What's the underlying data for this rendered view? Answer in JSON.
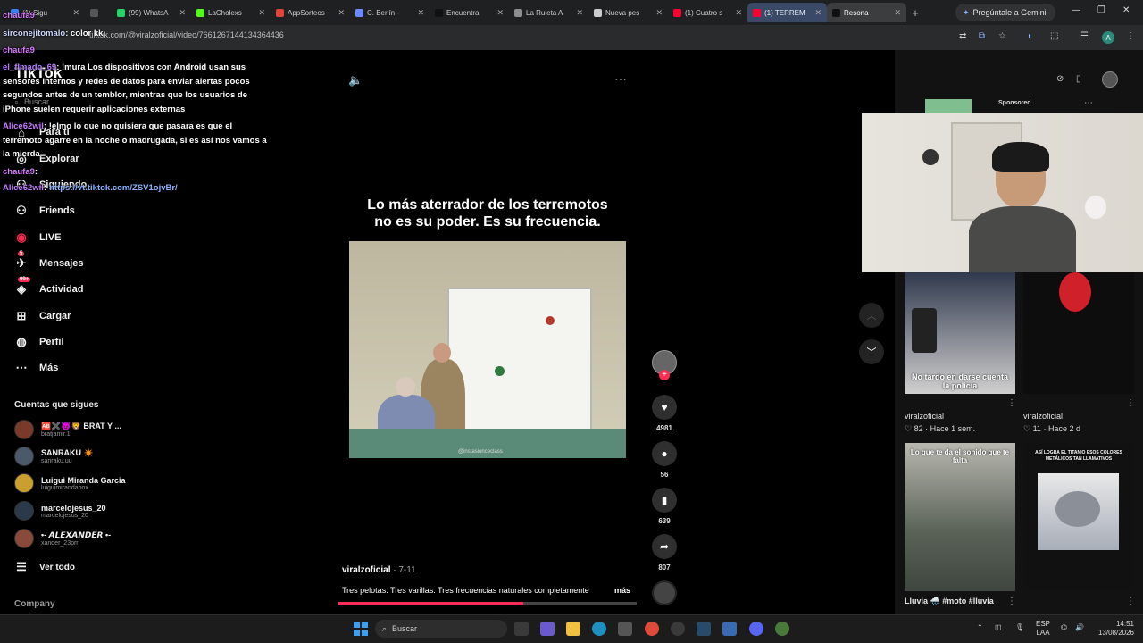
{
  "browser": {
    "tabs": [
      {
        "title": "(1) Sigu",
        "color": "#3b82f6"
      },
      {
        "title": "",
        "color": "#555555"
      },
      {
        "title": "(99) WhatsA",
        "color": "#25d366"
      },
      {
        "title": "LaCholexs",
        "color": "#53fc18"
      },
      {
        "title": "AppSorteos",
        "color": "#e0443a"
      },
      {
        "title": "C. Berlín -",
        "color": "#6b8afd"
      },
      {
        "title": "Encuentra",
        "color": "#111111"
      },
      {
        "title": "La Ruleta A",
        "color": "#8e8e8e"
      },
      {
        "title": "Nueva pes",
        "color": "#cccccc"
      },
      {
        "title": "(1) Cuatro s",
        "color": "#ff0033"
      },
      {
        "title": "(1) TERREM",
        "color": "#ff0033"
      },
      {
        "title": "Resona",
        "color": "#111111"
      }
    ],
    "gemini_label": "Pregúntale a Gemini",
    "url": "tiktok.com/@viralzoficial/video/7661267144134364436",
    "profile_initial": "A"
  },
  "chat": {
    "messages": [
      {
        "user": "chaufa9",
        "text": ""
      },
      {
        "user": "sirconejitomalo",
        "text": ": color kk"
      },
      {
        "user": "chaufa9",
        "text": ""
      },
      {
        "user": "el_flmado_69",
        "text": ": !mura Los dispositivos con Android usan sus sensores internos y redes de datos para enviar alertas pocos segundos antes de un temblor, mientras que los usuarios de iPhone suelen requerir aplicaciones externas"
      },
      {
        "user": "Alice62wil",
        "text": ": !elmo lo que no quisiera que pasara es que el terremoto agarre en la noche o madrugada, si es así nos vamos a la mierda"
      },
      {
        "user": "chaufa9",
        "text": ":"
      },
      {
        "user": "Alice62wil",
        "text": ":",
        "link": "https://vt.tiktok.com/ZSV1ojvBr/"
      }
    ]
  },
  "tiktok": {
    "logo": "TikTok",
    "search_placeholder": "Buscar",
    "nav": [
      {
        "label": "Para ti",
        "icon": "home-icon"
      },
      {
        "label": "Explorar",
        "icon": "compass-icon"
      },
      {
        "label": "Siguiendo",
        "icon": "following-icon"
      },
      {
        "label": "Friends",
        "icon": "friends-icon"
      },
      {
        "label": "LIVE",
        "icon": "live-icon"
      },
      {
        "label": "Mensajes",
        "icon": "messages-icon",
        "badge": "5"
      },
      {
        "label": "Actividad",
        "icon": "activity-icon",
        "badge": "99+"
      },
      {
        "label": "Cargar",
        "icon": "upload-icon"
      },
      {
        "label": "Perfil",
        "icon": "profile-icon"
      },
      {
        "label": "Más",
        "icon": "more-icon"
      }
    ],
    "following_title": "Cuentas que sigues",
    "following": [
      {
        "name": "🆎✖️😈🦁 BRAT Y ...",
        "handle": "bratjamir.1"
      },
      {
        "name": "SANRAKU ✴️",
        "handle": "sanraku.uu"
      },
      {
        "name": "Luigui Miranda Garcia",
        "handle": "luiguimirandabox"
      },
      {
        "name": "marcelojesus_20",
        "handle": "marcelojesus_20"
      },
      {
        "name": "•- 𝘼𝙇𝙀𝙓𝘼𝙉𝘿𝙀𝙍 •-",
        "handle": "xander_23prr"
      }
    ],
    "see_all": "Ver todo",
    "company": "Company"
  },
  "video": {
    "caption_line1": "Lo más aterrador de los terremotos",
    "caption_line2": "no es su poder. Es su frecuencia.",
    "watermark": "@instasienceclass",
    "author": "viralzoficial",
    "date": " · 7-11",
    "description": "Tres pelotas. Tres varillas. Tres frecuencias naturales completamente",
    "more": "más",
    "progress": 0.62,
    "likes": "4981",
    "comments": "56",
    "saves": "639",
    "shares": "807"
  },
  "right": {
    "sponsored": "Sponsored",
    "thumbs": [
      {
        "caption": "No tardo en darse cuenta la policia",
        "account": "viralzoficial",
        "likes": "82",
        "ago": "Hace 1 sem."
      },
      {
        "caption": "",
        "account": "viralzoficial",
        "likes": "11",
        "ago": "Hace 2 d"
      },
      {
        "caption": "Lo que te da el sonido que te falta",
        "account": "Lluvia 🌧️ #moto #lluvia",
        "likes": "",
        "ago": ""
      },
      {
        "caption": "ASÍ LOGRA EL TITANIO ESOS COLORES METÁLICOS TAN LLAMATIVOS",
        "account": "",
        "likes": "",
        "ago": ""
      }
    ]
  },
  "taskbar": {
    "search": "Buscar",
    "lang1": "ESP",
    "lang2": "LAA",
    "time": "14:51",
    "date": "13/08/2026"
  }
}
